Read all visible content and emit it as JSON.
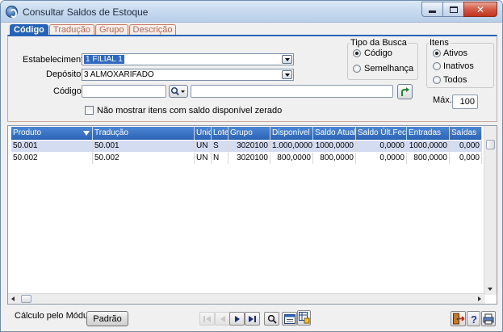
{
  "window": {
    "title": "Consultar Saldos de Estoque",
    "close_glyph": "✕"
  },
  "tabs": [
    {
      "label": "Código",
      "active": true
    },
    {
      "label": "Tradução",
      "active": false
    },
    {
      "label": "Grupo",
      "active": false
    },
    {
      "label": "Descrição",
      "active": false
    }
  ],
  "form": {
    "estabelecimento_label": "Estabelecimento",
    "estabelecimento_value": "1 FILIAL 1",
    "deposito_label": "Depósito",
    "deposito_value": "3 ALMOXARIFADO",
    "codigo_label": "Código",
    "codigo_value": "",
    "descricao_value": "",
    "hide_zero_label": "Não mostrar itens com saldo disponível zerado",
    "hide_zero_checked": false
  },
  "tipo_busca": {
    "legend": "Tipo da Busca",
    "options": [
      {
        "label": "Código",
        "selected": true
      },
      {
        "label": "Semelhança",
        "selected": false
      }
    ]
  },
  "itens": {
    "legend": "Itens",
    "options": [
      {
        "label": "Ativos",
        "selected": true
      },
      {
        "label": "Inativos",
        "selected": false
      },
      {
        "label": "Todos",
        "selected": false
      }
    ]
  },
  "max": {
    "label": "Máx.",
    "value": "100"
  },
  "grid": {
    "columns": [
      "Produto",
      "Tradução",
      "Unid",
      "Lote",
      "Grupo",
      "Disponível",
      "Saldo Atual",
      "Saldo Últ.Fech.",
      "Entradas",
      "Saídas"
    ],
    "rows": [
      [
        "50.001",
        "50.001",
        "UN",
        "S",
        "3020100",
        "1.000,0000",
        "1000,0000",
        "0,0000",
        "1000,0000",
        "0,000"
      ],
      [
        "50.002",
        "50.002",
        "UN",
        "N",
        "3020100",
        "800,0000",
        "800,0000",
        "0,0000",
        "800,0000",
        "0,000"
      ]
    ]
  },
  "footer": {
    "calculo_label": "Cálculo pelo Módulo:",
    "calculo_button": "Padrão"
  },
  "icons": {
    "app": "app-icon",
    "go": "go-arrow-icon",
    "search": "magnifier-icon",
    "help": "help-icon",
    "exit": "exit-door-icon",
    "print": "print-icon"
  }
}
